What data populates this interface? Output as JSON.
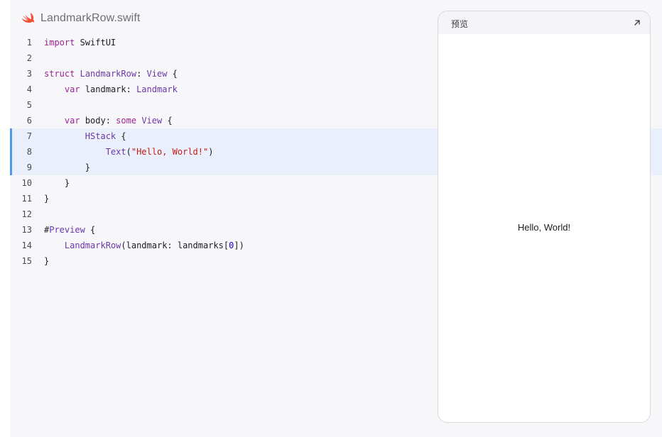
{
  "file": {
    "name": "LandmarkRow.swift",
    "icon": "swift-logo-icon",
    "icon_color": "#f05138"
  },
  "code": {
    "highlight_color": "#e9f0fc",
    "highlight_bar_color": "#4f9ae8",
    "lines": [
      {
        "num": "1",
        "highlight": false,
        "tokens": [
          {
            "t": "kw",
            "v": "import"
          },
          {
            "t": "p",
            "v": " SwiftUI"
          }
        ]
      },
      {
        "num": "2",
        "highlight": false,
        "tokens": []
      },
      {
        "num": "3",
        "highlight": false,
        "tokens": [
          {
            "t": "kw",
            "v": "struct"
          },
          {
            "t": "p",
            "v": " "
          },
          {
            "t": "ty",
            "v": "LandmarkRow"
          },
          {
            "t": "p",
            "v": ": "
          },
          {
            "t": "ty",
            "v": "View"
          },
          {
            "t": "p",
            "v": " {"
          }
        ]
      },
      {
        "num": "4",
        "highlight": false,
        "tokens": [
          {
            "t": "p",
            "v": "    "
          },
          {
            "t": "kw",
            "v": "var"
          },
          {
            "t": "p",
            "v": " landmark: "
          },
          {
            "t": "ty",
            "v": "Landmark"
          }
        ]
      },
      {
        "num": "5",
        "highlight": false,
        "tokens": []
      },
      {
        "num": "6",
        "highlight": false,
        "tokens": [
          {
            "t": "p",
            "v": "    "
          },
          {
            "t": "kw",
            "v": "var"
          },
          {
            "t": "p",
            "v": " body: "
          },
          {
            "t": "kw",
            "v": "some"
          },
          {
            "t": "p",
            "v": " "
          },
          {
            "t": "ty",
            "v": "View"
          },
          {
            "t": "p",
            "v": " {"
          }
        ]
      },
      {
        "num": "7",
        "highlight": true,
        "tokens": [
          {
            "t": "p",
            "v": "        "
          },
          {
            "t": "ty",
            "v": "HStack"
          },
          {
            "t": "p",
            "v": " {"
          }
        ]
      },
      {
        "num": "8",
        "highlight": true,
        "tokens": [
          {
            "t": "p",
            "v": "            "
          },
          {
            "t": "ty",
            "v": "Text"
          },
          {
            "t": "p",
            "v": "("
          },
          {
            "t": "str",
            "v": "\"Hello, World!\""
          },
          {
            "t": "p",
            "v": ")"
          }
        ]
      },
      {
        "num": "9",
        "highlight": true,
        "tokens": [
          {
            "t": "p",
            "v": "        }"
          }
        ]
      },
      {
        "num": "10",
        "highlight": false,
        "tokens": [
          {
            "t": "p",
            "v": "    }"
          }
        ]
      },
      {
        "num": "11",
        "highlight": false,
        "tokens": [
          {
            "t": "p",
            "v": "}"
          }
        ]
      },
      {
        "num": "12",
        "highlight": false,
        "tokens": []
      },
      {
        "num": "13",
        "highlight": false,
        "tokens": [
          {
            "t": "p",
            "v": "#"
          },
          {
            "t": "ty",
            "v": "Preview"
          },
          {
            "t": "p",
            "v": " {"
          }
        ]
      },
      {
        "num": "14",
        "highlight": false,
        "tokens": [
          {
            "t": "p",
            "v": "    "
          },
          {
            "t": "ty",
            "v": "LandmarkRow"
          },
          {
            "t": "p",
            "v": "(landmark: landmarks["
          },
          {
            "t": "num",
            "v": "0"
          },
          {
            "t": "p",
            "v": "])"
          }
        ]
      },
      {
        "num": "15",
        "highlight": false,
        "tokens": [
          {
            "t": "p",
            "v": "}"
          }
        ]
      }
    ]
  },
  "preview": {
    "title": "预览",
    "expand_icon": "expand-arrow-icon",
    "content_text": "Hello, World!"
  }
}
